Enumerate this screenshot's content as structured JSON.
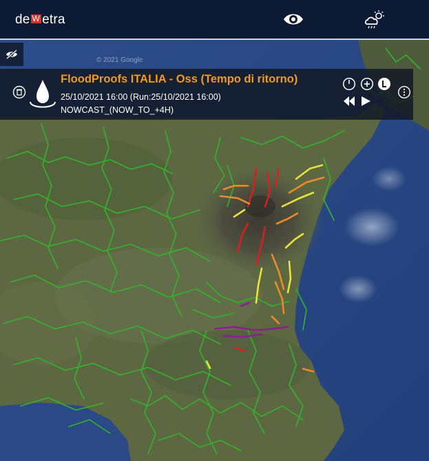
{
  "app": {
    "logo_prefix": "de",
    "logo_mid": "W",
    "logo_suffix": "etra"
  },
  "header": {
    "icons": [
      "eye-icon",
      "weather-cloud-sun-icon"
    ]
  },
  "map": {
    "watermark": "© 2021 Google"
  },
  "layer_panel": {
    "title": "FloodProofs ITALIA - Oss (Tempo di ritorno)",
    "datetime": "25/10/2021 16:00 (Run:25/10/2021 16:00)",
    "mode": "NOWCAST_(NOW_TO_+4H)",
    "icons": [
      "eye-slash-icon",
      "delete-icon",
      "water-drop-icon",
      "clock-icon",
      "zoom-in-icon",
      "legend-icon",
      "more-options-icon",
      "rewind-icon",
      "play-icon"
    ]
  },
  "colors": {
    "title_orange": "#f39a1a",
    "river_green": "#32b52a",
    "return_red": "#d8201e",
    "return_orange": "#ef8a28",
    "return_yellow": "#ece33a",
    "return_purple": "#8c1f8f",
    "sea_blue": "#2b4a86"
  }
}
